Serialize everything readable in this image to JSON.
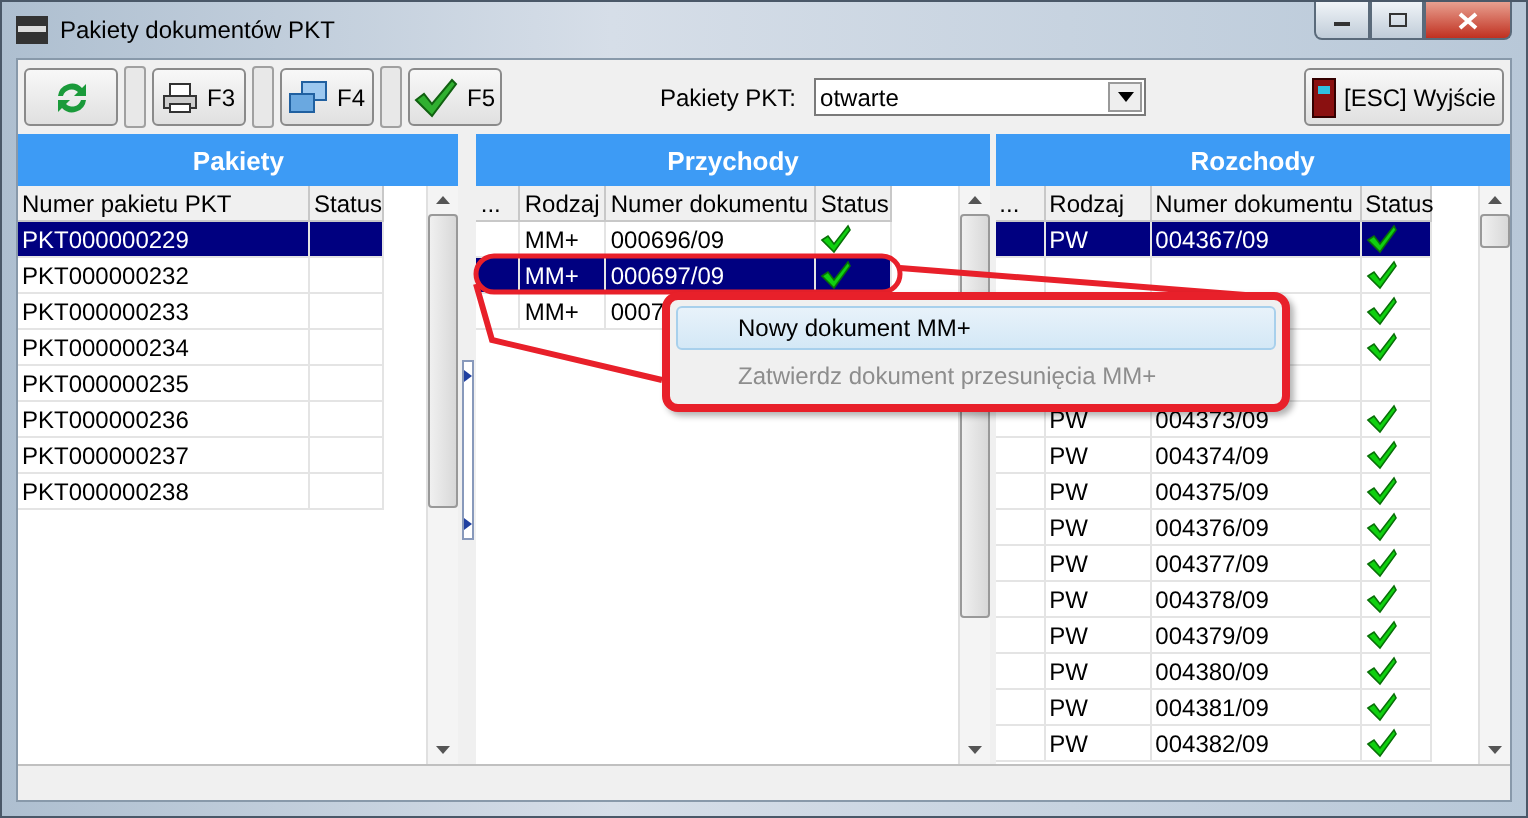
{
  "window": {
    "title": "Pakiety dokumentów PKT"
  },
  "toolbar": {
    "buttons": [
      {
        "kind": "refresh"
      },
      {
        "kind": "print",
        "label": "F3"
      },
      {
        "kind": "windows",
        "label": "F4"
      },
      {
        "kind": "check",
        "label": "F5"
      }
    ],
    "filter_label": "Pakiety PKT:",
    "filter_value": "otwarte",
    "exit_label": "[ESC] Wyjście"
  },
  "packages": {
    "title": "Pakiety",
    "columns": [
      "Numer pakietu PKT",
      "Status"
    ],
    "rows": [
      {
        "number": "PKT000000229",
        "selected": true
      },
      {
        "number": "PKT000000232",
        "selected": false
      },
      {
        "number": "PKT000000233",
        "selected": false
      },
      {
        "number": "PKT000000234",
        "selected": false
      },
      {
        "number": "PKT000000235",
        "selected": false
      },
      {
        "number": "PKT000000236",
        "selected": false
      },
      {
        "number": "PKT000000237",
        "selected": false
      },
      {
        "number": "PKT000000238",
        "selected": false
      }
    ]
  },
  "income": {
    "title": "Przychody",
    "columns": [
      "...",
      "Rodzaj",
      "Numer dokumentu",
      "Status"
    ],
    "rows": [
      {
        "type": "MM+",
        "number": "000696/09",
        "checked": true,
        "selected": false
      },
      {
        "type": "MM+",
        "number": "000697/09",
        "checked": true,
        "selected": true
      },
      {
        "type": "MM+",
        "number": "0007",
        "selected": false
      }
    ]
  },
  "outgoing": {
    "title": "Rozchody",
    "columns": [
      "...",
      "Rodzaj",
      "Numer dokumentu",
      "Status"
    ],
    "rows": [
      {
        "type": "PW",
        "number": "004367/09",
        "checked": true,
        "selected": true
      },
      {
        "checked": true,
        "selected": false
      },
      {
        "checked": true,
        "selected": false
      },
      {
        "checked": true,
        "selected": false
      },
      {
        "checked": false,
        "selected": false
      },
      {
        "type": "PW",
        "number": "004373/09",
        "checked": true,
        "selected": false
      },
      {
        "type": "PW",
        "number": "004374/09",
        "checked": true,
        "selected": false
      },
      {
        "type": "PW",
        "number": "004375/09",
        "checked": true,
        "selected": false
      },
      {
        "type": "PW",
        "number": "004376/09",
        "checked": true,
        "selected": false
      },
      {
        "type": "PW",
        "number": "004377/09",
        "checked": true,
        "selected": false
      },
      {
        "type": "PW",
        "number": "004378/09",
        "checked": true,
        "selected": false
      },
      {
        "type": "PW",
        "number": "004379/09",
        "checked": true,
        "selected": false
      },
      {
        "type": "PW",
        "number": "004380/09",
        "checked": true,
        "selected": false
      },
      {
        "type": "PW",
        "number": "004381/09",
        "checked": true,
        "selected": false
      },
      {
        "type": "PW",
        "number": "004382/09",
        "checked": true,
        "selected": false
      }
    ]
  },
  "context_menu": {
    "items": [
      {
        "label": "Nowy dokument MM+",
        "highlighted": true,
        "disabled": false
      },
      {
        "label": "Zatwierdz dokument przesunięcia MM+",
        "highlighted": false,
        "disabled": true
      }
    ]
  }
}
